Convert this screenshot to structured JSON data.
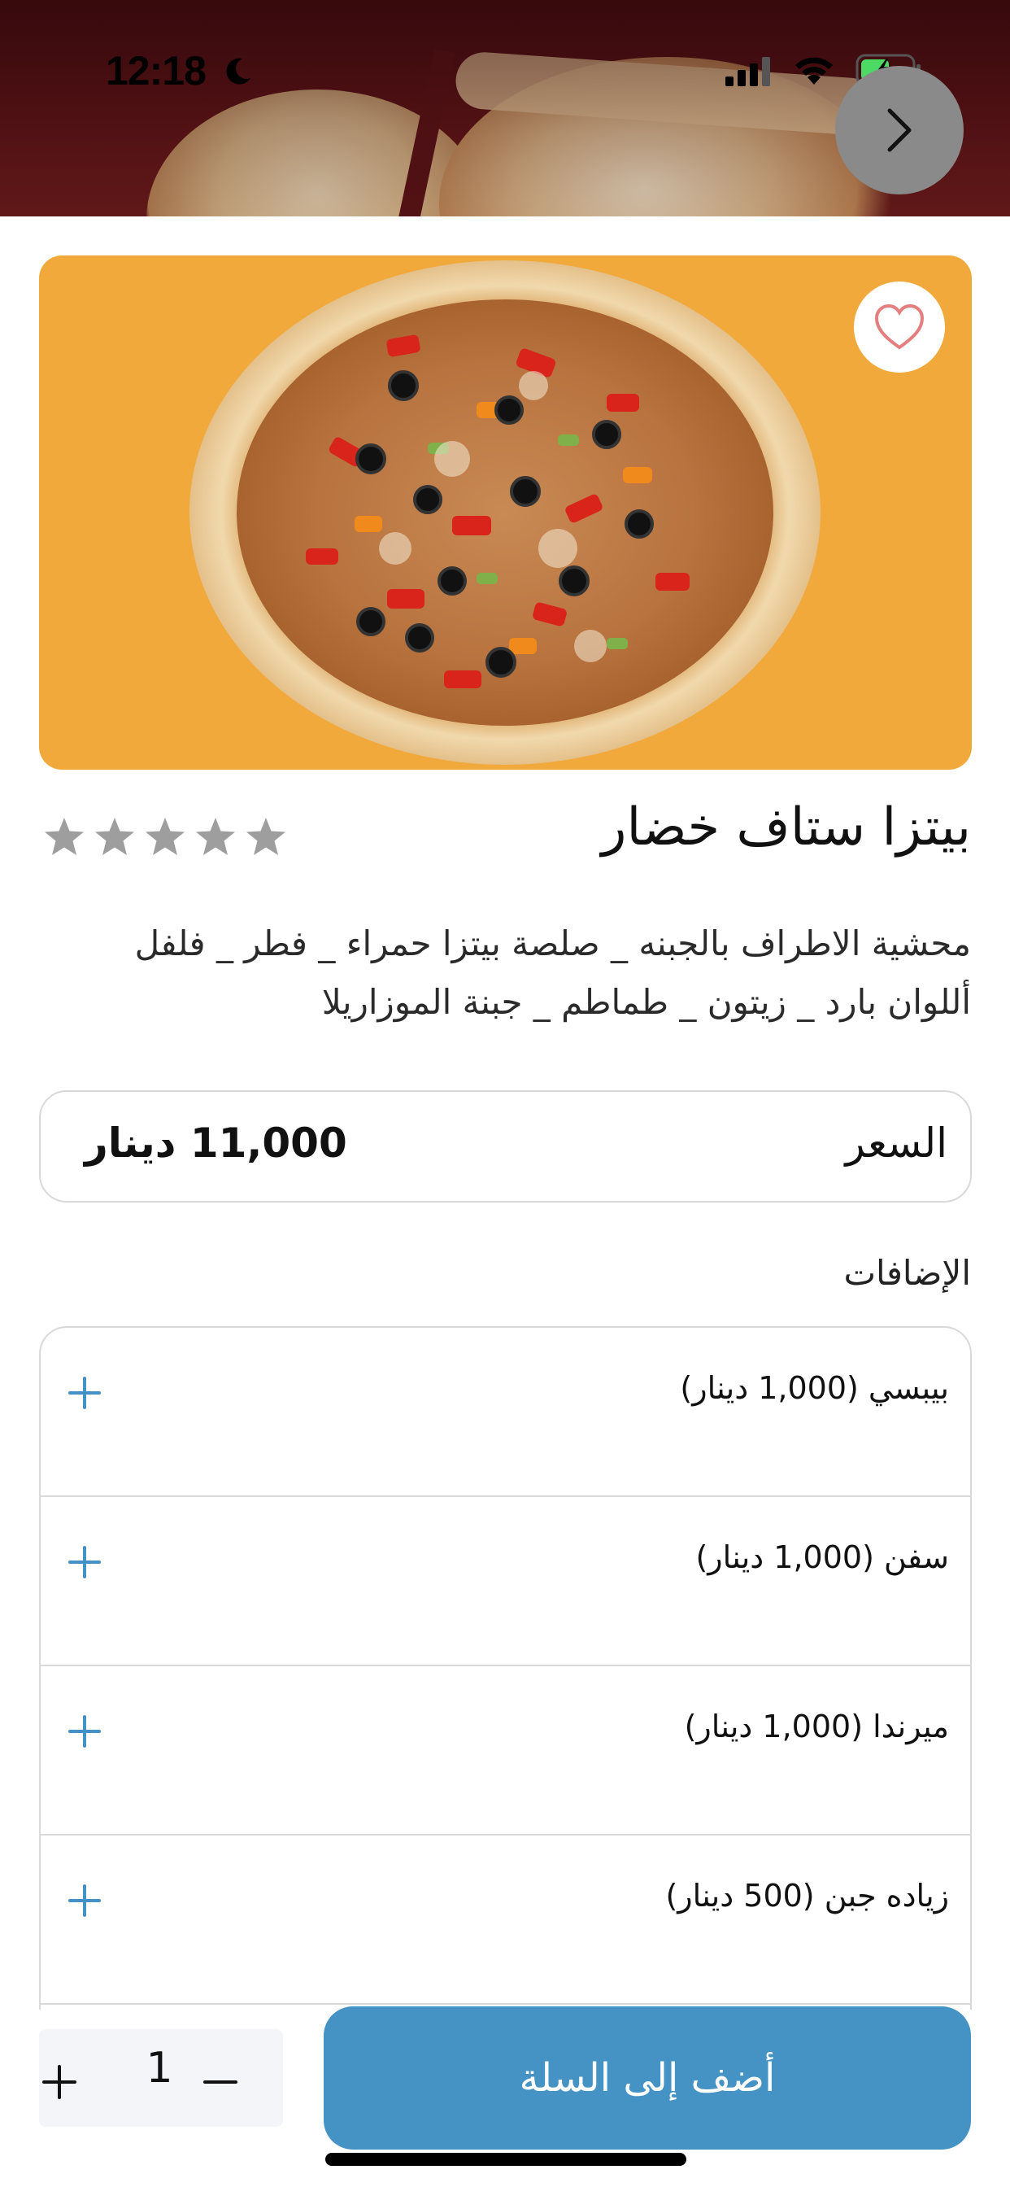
{
  "status_bar": {
    "time": "12:18"
  },
  "product": {
    "title": "بيتزا ستاف خضار",
    "rating": {
      "stars_filled": 0,
      "stars_total": 5
    },
    "description": "محشية الاطراف بالجبنه _ صلصة بيتزا حمراء _ فطر _ فلفل أللوان بارد _ زيتون _ طماطم _ جبنة الموزاريلا"
  },
  "price": {
    "label": "السعر",
    "value": "11,000 دينار"
  },
  "addons": {
    "title": "الإضافات",
    "items": [
      {
        "label": "بيبسي  (1,000 دينار)"
      },
      {
        "label": "سفن  (1,000 دينار)"
      },
      {
        "label": "ميرندا  (1,000 دينار)"
      },
      {
        "label": "زياده جبن  (500 دينار)"
      }
    ]
  },
  "cart": {
    "quantity": "1",
    "add_button_label": "أضف إلى السلة"
  },
  "colors": {
    "accent": "#4592c5",
    "image_bg": "#f2a93b",
    "star_inactive": "#9e9e9e",
    "heart": "#e47f7f"
  },
  "icons": [
    "moon-icon",
    "signal-icon",
    "wifi-icon",
    "battery-icon",
    "chevron-right-icon",
    "heart-icon",
    "star-icon",
    "plus-icon",
    "minus-icon"
  ]
}
